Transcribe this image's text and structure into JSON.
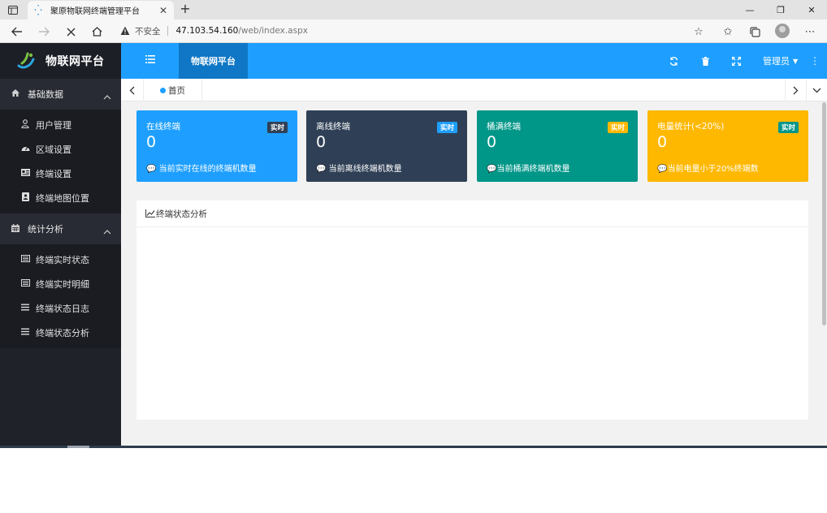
{
  "browser": {
    "tab_title": "聚原物联网终端管理平台",
    "insecure_label": "不安全",
    "url_host": "47.103.54.160",
    "url_path": "/web/index.aspx"
  },
  "app": {
    "logo_text": "物联网平台",
    "top_tab": "物联网平台",
    "admin_label": "管理员",
    "home_tab": "首页",
    "colors": {
      "topbar": "#1e9fff",
      "sidebar": "#20222a",
      "card_blue": "#1e9fff",
      "card_dark": "#2f4056",
      "card_green": "#009688",
      "card_yellow": "#ffb800"
    }
  },
  "sidebar": {
    "groups": [
      {
        "label": "基础数据",
        "icon": "home-icon",
        "items": [
          {
            "label": "用户管理",
            "icon": "user-icon"
          },
          {
            "label": "区域设置",
            "icon": "dashboard-icon"
          },
          {
            "label": "终端设置",
            "icon": "id-card-icon"
          },
          {
            "label": "终端地图位置",
            "icon": "map-pin-icon"
          }
        ]
      },
      {
        "label": "统计分析",
        "icon": "calendar-icon",
        "items": [
          {
            "label": "终端实时状态",
            "icon": "list-alt-icon"
          },
          {
            "label": "终端实时明细",
            "icon": "list-alt-icon"
          },
          {
            "label": "终端状态日志",
            "icon": "bars-icon"
          },
          {
            "label": "终端状态分析",
            "icon": "bars-icon"
          }
        ]
      }
    ]
  },
  "cards": [
    {
      "title": "在线终端",
      "badge": "实时",
      "value": "0",
      "desc": "当前实时在线的终端机数量"
    },
    {
      "title": "离线终端",
      "badge": "实时",
      "value": "0",
      "desc": "当前离线终端机数量"
    },
    {
      "title": "桶满终端",
      "badge": "实时",
      "value": "0",
      "desc": "当前桶满终端机数量"
    },
    {
      "title": "电量统计(<20%)",
      "badge": "实时",
      "value": "0",
      "desc": "当前电量小于20%终端数"
    }
  ],
  "panel": {
    "title": "终端状态分析"
  }
}
